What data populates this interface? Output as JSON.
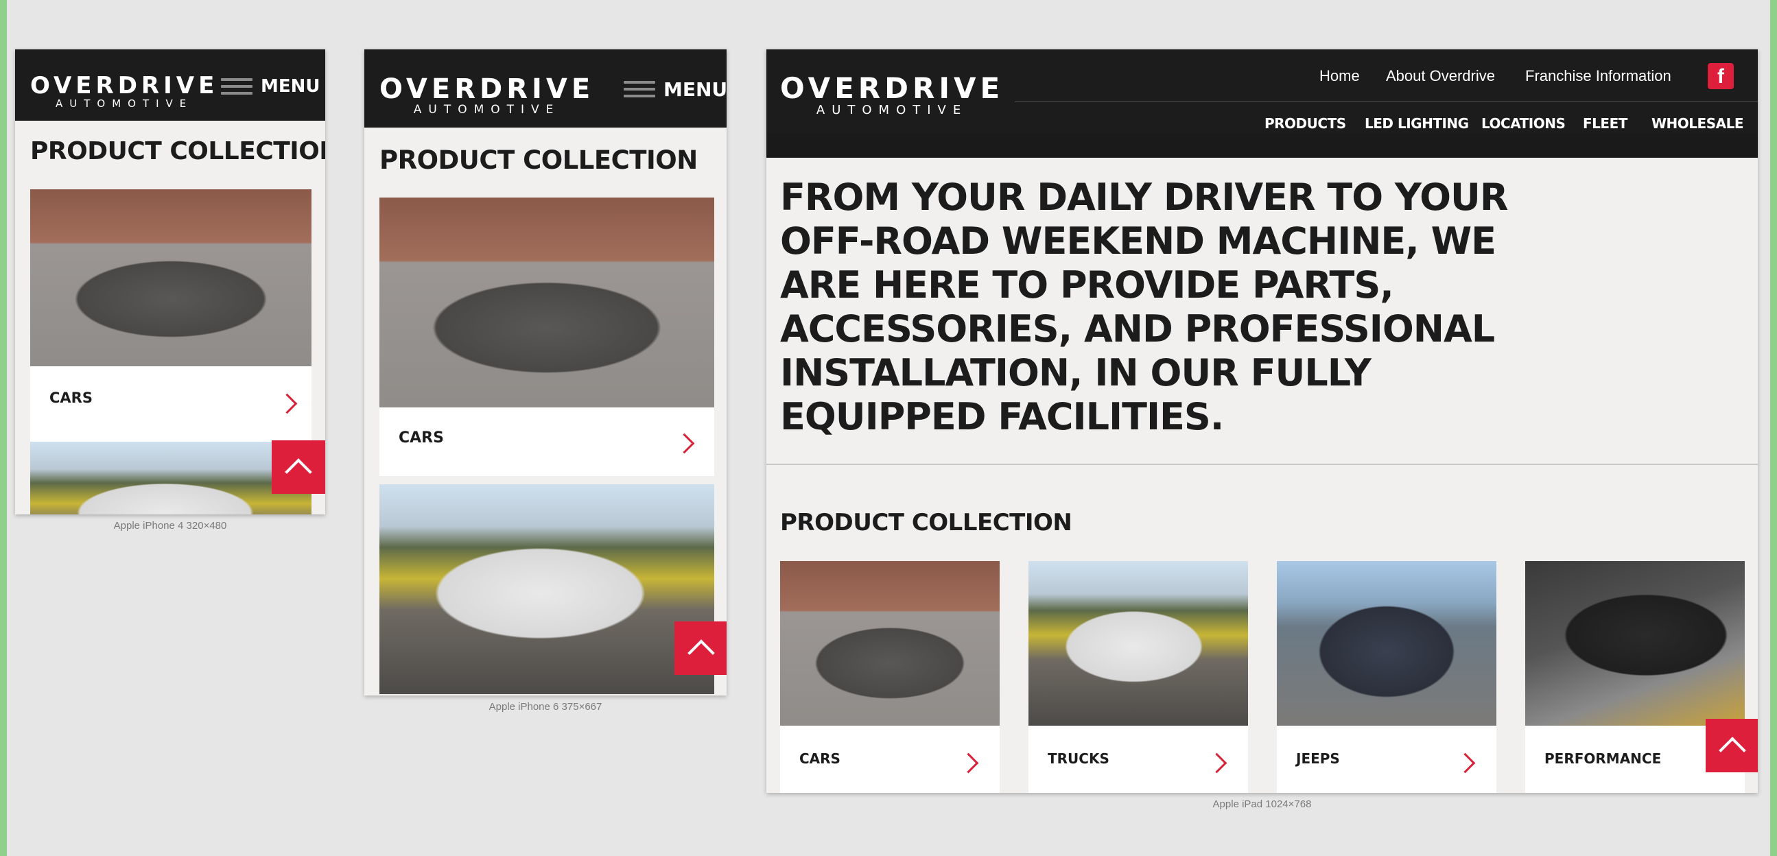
{
  "brand": {
    "logo_line1": "OVERDRIVE",
    "logo_line2": "AUTOMOTIVE",
    "accent": "#dd1f3b",
    "dark": "#1c1c1c"
  },
  "mobile": {
    "menu_label": "MENU",
    "section_title": "PRODUCT COLLECTION"
  },
  "devices": {
    "iphone4": {
      "caption": "Apple iPhone 4    320×480"
    },
    "iphone6": {
      "caption": "Apple iPhone 6    375×667"
    },
    "ipad": {
      "caption": "Apple iPad    1024×768"
    }
  },
  "tablet": {
    "top_nav": [
      {
        "label": "Home"
      },
      {
        "label": "About Overdrive"
      },
      {
        "label": "Franchise Information"
      }
    ],
    "facebook_glyph": "f",
    "main_nav": [
      {
        "label": "PRODUCTS"
      },
      {
        "label": "LED LIGHTING"
      },
      {
        "label": "LOCATIONS"
      },
      {
        "label": "FLEET"
      },
      {
        "label": "WHOLESALE"
      }
    ],
    "hero_text": "FROM YOUR DAILY DRIVER TO YOUR OFF-ROAD WEEKEND MACHINE, WE ARE HERE TO PROVIDE PARTS, ACCESSORIES, AND PROFESSIONAL INSTALLATION, IN OUR FULLY EQUIPPED FACILITIES.",
    "section_title": "PRODUCT COLLECTION"
  },
  "products": [
    {
      "label": "CARS",
      "image": "grey-coupe-photo"
    },
    {
      "label": "TRUCKS",
      "image": "white-pickup-photo"
    },
    {
      "label": "JEEPS",
      "image": "black-jeep-photo"
    },
    {
      "label": "PERFORMANCE",
      "image": "exhaust-undercarriage-photo"
    }
  ],
  "icons": {
    "menu": "hamburger-icon",
    "arrow": "chevron-right-icon",
    "back_to_top": "chevron-up-icon",
    "social": "facebook-icon"
  }
}
